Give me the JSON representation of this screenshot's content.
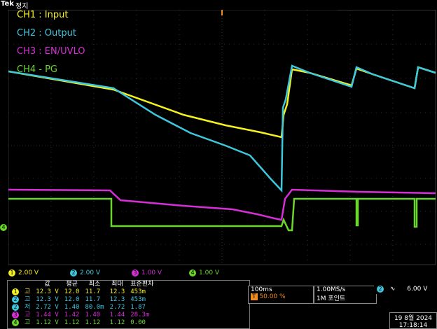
{
  "header": {
    "brand": "Tek",
    "status": "정지"
  },
  "legend": {
    "ch1": "CH1 : Input",
    "ch2": "CH2 : Output",
    "ch3": "CH3 : EN/UVLO",
    "ch4": "CH4 - PG"
  },
  "colors": {
    "ch1": "#f6f21b",
    "ch2": "#3ec7dd",
    "ch3": "#d62fd6",
    "ch4": "#6bd62c",
    "grid": "#5a5a5a"
  },
  "channels": [
    {
      "num": "1",
      "scale": "2.00 V",
      "color": "#f6f21b"
    },
    {
      "num": "2",
      "scale": "2.00 V",
      "color": "#3ec7dd"
    },
    {
      "num": "3",
      "scale": "1.00 V",
      "color": "#d62fd6"
    },
    {
      "num": "4",
      "scale": "1.00 V",
      "color": "#6bd62c"
    }
  ],
  "measurements": {
    "headers": [
      "값",
      "평균",
      "최소",
      "최대",
      "표준편차"
    ],
    "rows": [
      {
        "ch": "1",
        "type": "고",
        "value": "12.3 V",
        "mean": "12.0",
        "min": "11.7",
        "max": "12.3",
        "std": "453m"
      },
      {
        "ch": "2",
        "type": "고",
        "value": "12.3 V",
        "mean": "12.0",
        "min": "11.7",
        "max": "12.3",
        "std": "453m"
      },
      {
        "ch": "2",
        "type": "저",
        "value": "2.72 V",
        "mean": "1.40",
        "min": "80.0m",
        "max": "2.72",
        "std": "1.87"
      },
      {
        "ch": "3",
        "type": "고",
        "value": "1.44 V",
        "mean": "1.42",
        "min": "1.40",
        "max": "1.44",
        "std": "28.3m"
      },
      {
        "ch": "4",
        "type": "고",
        "value": "1.12 V",
        "mean": "1.12",
        "min": "1.12",
        "max": "1.12",
        "std": "0.00"
      }
    ]
  },
  "timebase": {
    "scale": "100ms",
    "trigger_pos": "50.00 %"
  },
  "acquisition": {
    "rate": "1.00MS/s",
    "points": "1M 포인트"
  },
  "trigger": {
    "channel": "2",
    "slope": "∿",
    "level": "6.00 V"
  },
  "datetime": {
    "date": "19 8월 2024",
    "time": "17:18:14"
  },
  "markers": {
    "ground4": "4",
    "trigger_top": "T"
  }
}
